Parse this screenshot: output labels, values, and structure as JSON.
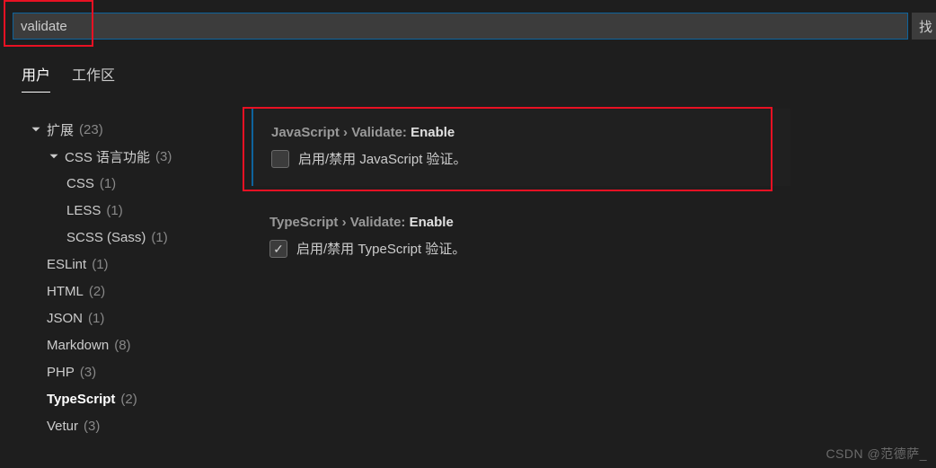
{
  "search": {
    "value": "validate",
    "side_label": "找"
  },
  "tabs": {
    "user": "用户",
    "workspace": "工作区"
  },
  "sidebar": {
    "ext_label": "扩展",
    "ext_count": "(23)",
    "css_label": "CSS 语言功能",
    "css_count": "(3)",
    "items": [
      {
        "label": "CSS",
        "count": "(1)"
      },
      {
        "label": "LESS",
        "count": "(1)"
      },
      {
        "label": "SCSS (Sass)",
        "count": "(1)"
      }
    ],
    "flat": [
      {
        "label": "ESLint",
        "count": "(1)"
      },
      {
        "label": "HTML",
        "count": "(2)"
      },
      {
        "label": "JSON",
        "count": "(1)"
      },
      {
        "label": "Markdown",
        "count": "(8)"
      },
      {
        "label": "PHP",
        "count": "(3)"
      },
      {
        "label": "TypeScript",
        "count": "(2)"
      },
      {
        "label": "Vetur",
        "count": "(3)"
      }
    ]
  },
  "settings": {
    "js": {
      "path": "JavaScript › Validate: ",
      "leaf": "Enable",
      "desc": "启用/禁用 JavaScript 验证。"
    },
    "ts": {
      "path": "TypeScript › Validate: ",
      "leaf": "Enable",
      "desc": "启用/禁用 TypeScript 验证。"
    }
  },
  "watermark": "CSDN @范德萨_"
}
